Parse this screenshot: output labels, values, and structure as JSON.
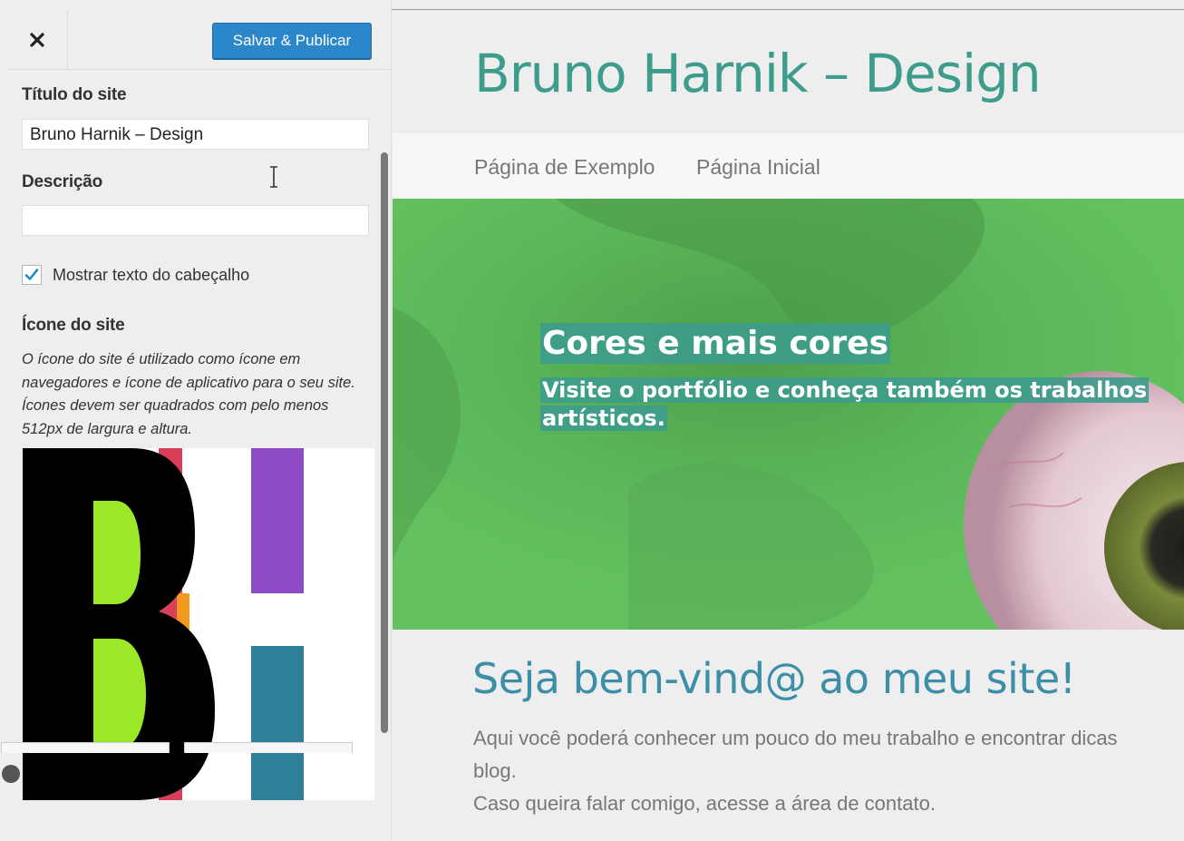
{
  "sidebar": {
    "close_icon": "close-icon",
    "publish_label": "Salvar & Publicar",
    "site_title_label": "Título do site",
    "site_title_value": "Bruno Harnik – Design",
    "description_label": "Descrição",
    "description_value": "",
    "show_header_text_label": "Mostrar texto do cabeçalho",
    "show_header_text_checked": true,
    "site_icon_label": "Ícone do site",
    "site_icon_description": "O ícone do site é utilizado como ícone em navegadores e ícone de aplicativo para o seu site. Ícones devem ser quadrados com pelo menos 512px de largura e altura.",
    "site_icon_image": "bh-logo",
    "colors": {
      "publish": "#2b87c9",
      "panel_bg": "#eeeeee"
    }
  },
  "preview": {
    "site_title": "Bruno Harnik – Design",
    "nav": [
      {
        "label": "Página de Exemplo"
      },
      {
        "label": "Página Inicial"
      }
    ],
    "hero_title": "Cores e mais cores",
    "hero_subtitle": "Visite o portfólio e conheça também os trabalhos artísticos.",
    "welcome_heading": "Seja bem-vind@ ao meu site!",
    "body_lines": [
      "Aqui você poderá conhecer um pouco do meu trabalho e encontrar dicas",
      "blog.",
      "Caso queira falar comigo, acesse a área de contato."
    ],
    "colors": {
      "accent": "#3d9c8c",
      "heading": "#3d8ea8",
      "hero_bg": "#5cb85a"
    }
  }
}
